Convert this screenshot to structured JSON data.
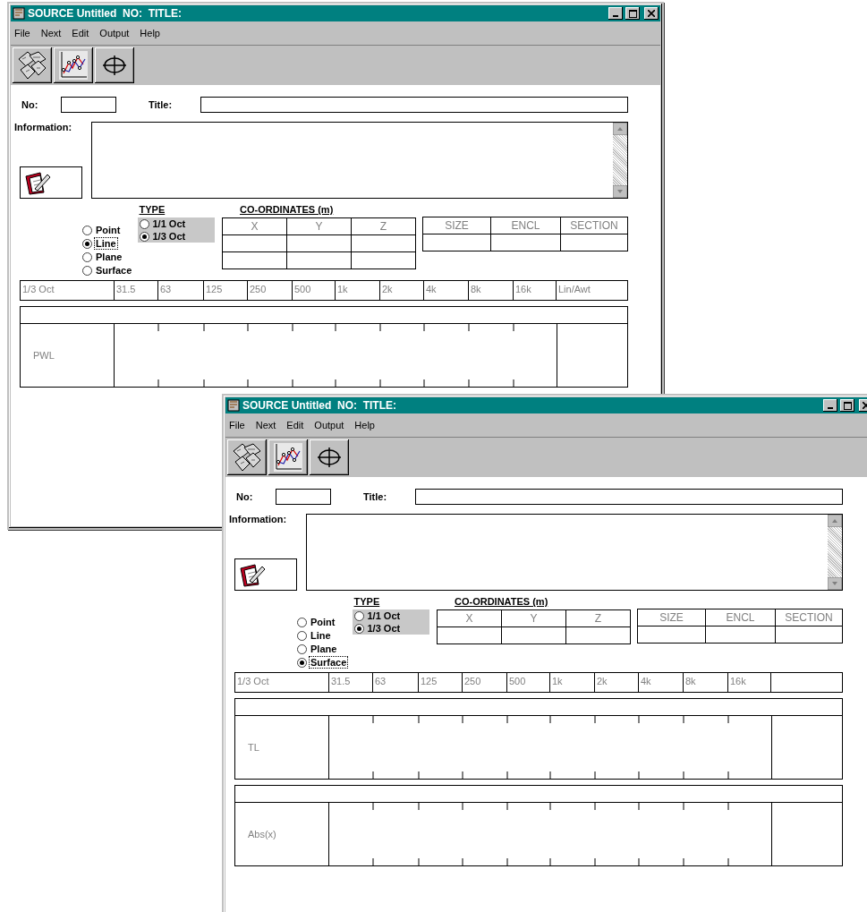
{
  "windows": [
    {
      "title": "SOURCE Untitled  NO:  TITLE:",
      "menu": [
        {
          "label": "File"
        },
        {
          "label": "Next"
        },
        {
          "label": "Edit"
        },
        {
          "label": "Output"
        },
        {
          "label": "Help"
        }
      ],
      "no_label": "No:",
      "title_label": "Title:",
      "information_label": "Information:",
      "shape_options": [
        {
          "label": "Point",
          "selected": false
        },
        {
          "label": "Line",
          "selected": true
        },
        {
          "label": "Plane",
          "selected": false
        },
        {
          "label": "Surface",
          "selected": false
        }
      ],
      "type_label": "TYPE",
      "type_options": [
        {
          "label": "1/1 Oct",
          "selected": false
        },
        {
          "label": "1/3 Oct",
          "selected": true
        }
      ],
      "coordinates_title": "CO-ORDINATES (m)",
      "coordinate_columns": [
        "X",
        "Y",
        "Z"
      ],
      "coordinate_rows": [
        {
          "kind": "blank"
        },
        {
          "kind": "blank"
        }
      ],
      "placement_columns": [
        "SIZE",
        "ENCL",
        "SECTION"
      ],
      "band_header": "1/3 Oct",
      "bands": [
        "31.5",
        "63",
        "125",
        "250",
        "500",
        "1k",
        "2k",
        "4k",
        "8k",
        "16k"
      ],
      "band_total": "Lin/Awt",
      "panels": [
        {
          "label": "PWL"
        }
      ]
    },
    {
      "title": "SOURCE Untitled  NO:  TITLE:",
      "menu": [
        {
          "label": "File"
        },
        {
          "label": "Next"
        },
        {
          "label": "Edit"
        },
        {
          "label": "Output"
        },
        {
          "label": "Help"
        }
      ],
      "no_label": "No:",
      "title_label": "Title:",
      "information_label": "Information:",
      "shape_options": [
        {
          "label": "Point",
          "selected": false
        },
        {
          "label": "Line",
          "selected": false
        },
        {
          "label": "Plane",
          "selected": false
        },
        {
          "label": "Surface",
          "selected": true
        }
      ],
      "type_label": "TYPE",
      "type_options": [
        {
          "label": "1/1 Oct",
          "selected": false
        },
        {
          "label": "1/3 Oct",
          "selected": true
        }
      ],
      "coordinates_title": "CO-ORDINATES (m)",
      "coordinate_columns": [
        "X",
        "Y",
        "Z"
      ],
      "coordinate_rows": [
        {
          "kind": "blank"
        }
      ],
      "placement_columns": [
        "SIZE",
        "ENCL",
        "SECTION"
      ],
      "band_header": "1/3 Oct",
      "bands": [
        "31.5",
        "63",
        "125",
        "250",
        "500",
        "1k",
        "2k",
        "4k",
        "8k",
        "16k"
      ],
      "panels": [
        {
          "label": "TL"
        },
        {
          "label": "Abs(x)"
        }
      ]
    }
  ]
}
